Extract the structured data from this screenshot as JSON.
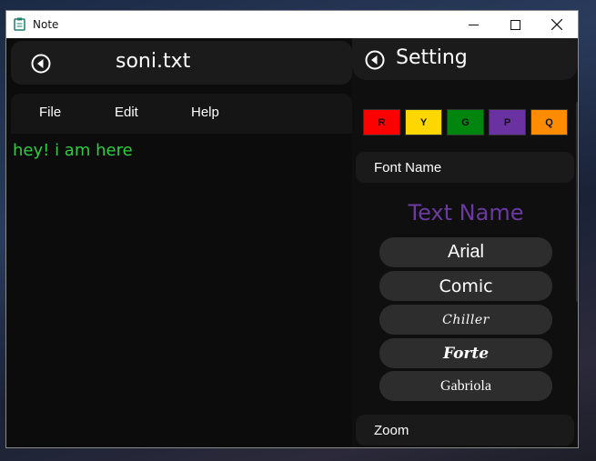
{
  "window": {
    "title": "Note",
    "icons": {
      "app": "clipboard-icon",
      "minimize": "minimize-icon",
      "maximize": "maximize-icon",
      "close": "close-icon"
    }
  },
  "editor": {
    "filename": "soni.txt",
    "menu": [
      "File",
      "Edit",
      "Help"
    ],
    "content": "hey! i am here",
    "content_color": "#2ecc40"
  },
  "settings": {
    "title": "Setting",
    "colors": [
      {
        "label": "R",
        "color": "#ff0000"
      },
      {
        "label": "Y",
        "color": "#ffd700"
      },
      {
        "label": "G",
        "color": "#00860f"
      },
      {
        "label": "P",
        "color": "#6a32a0"
      },
      {
        "label": "Q",
        "color": "#ff8c00"
      }
    ],
    "font_section_label": "Font Name",
    "preview_text": "Text Name",
    "preview_color": "#6a3aa0",
    "fonts": [
      "Arial",
      "Comic",
      "Chiller",
      "Forte",
      "Gabriola"
    ],
    "zoom_label": "Zoom"
  }
}
